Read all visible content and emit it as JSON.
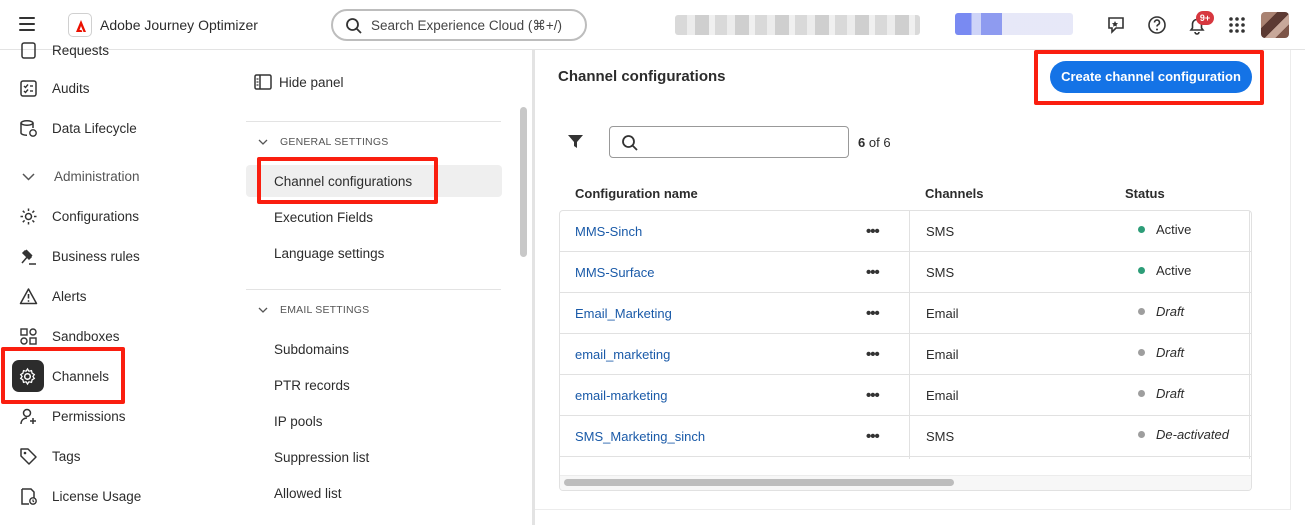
{
  "header": {
    "app_name": "Adobe Journey Optimizer",
    "search_placeholder": "Search Experience Cloud (⌘+/)",
    "notifications_badge": "9+"
  },
  "leftnav": {
    "items": [
      {
        "label": "Requests",
        "icon": "requests-icon"
      },
      {
        "label": "Audits",
        "icon": "audits-icon"
      },
      {
        "label": "Data Lifecycle",
        "icon": "data-lifecycle-icon"
      },
      {
        "label": "Administration",
        "icon": "chevron-down-icon"
      },
      {
        "label": "Configurations",
        "icon": "gear-icon"
      },
      {
        "label": "Business rules",
        "icon": "gavel-icon"
      },
      {
        "label": "Alerts",
        "icon": "alert-icon"
      },
      {
        "label": "Sandboxes",
        "icon": "sandboxes-icon"
      },
      {
        "label": "Channels",
        "icon": "channels-gear-icon"
      },
      {
        "label": "Permissions",
        "icon": "permissions-icon"
      },
      {
        "label": "Tags",
        "icon": "tag-icon"
      },
      {
        "label": "License Usage",
        "icon": "license-icon"
      }
    ]
  },
  "midpanel": {
    "hide_panel_label": "Hide panel",
    "general_header": "GENERAL SETTINGS",
    "general_items": [
      "Channel configurations",
      "Execution Fields",
      "Language settings"
    ],
    "email_header": "EMAIL SETTINGS",
    "email_items": [
      "Subdomains",
      "PTR records",
      "IP pools",
      "Suppression list",
      "Allowed list"
    ]
  },
  "main": {
    "title": "Channel configurations",
    "create_button": "Create channel configuration",
    "result_count": "6",
    "result_total": "of 6",
    "columns": [
      "Configuration name",
      "Channels",
      "Status"
    ],
    "rows": [
      {
        "name": "MMS-Sinch",
        "channel": "SMS",
        "status": "Active"
      },
      {
        "name": "MMS-Surface",
        "channel": "SMS",
        "status": "Active"
      },
      {
        "name": "Email_Marketing",
        "channel": "Email",
        "status": "Draft"
      },
      {
        "name": "email_marketing",
        "channel": "Email",
        "status": "Draft"
      },
      {
        "name": "email-marketing",
        "channel": "Email",
        "status": "Draft"
      },
      {
        "name": "SMS_Marketing_sinch",
        "channel": "SMS",
        "status": "De-activated"
      }
    ],
    "more_glyph": "•••"
  },
  "colors": {
    "accent": "#1473e6",
    "highlight": "#fa1e0f",
    "status_active": "#2d9d78",
    "status_inactive": "#9e9e9e",
    "link": "#1a5aa8"
  }
}
